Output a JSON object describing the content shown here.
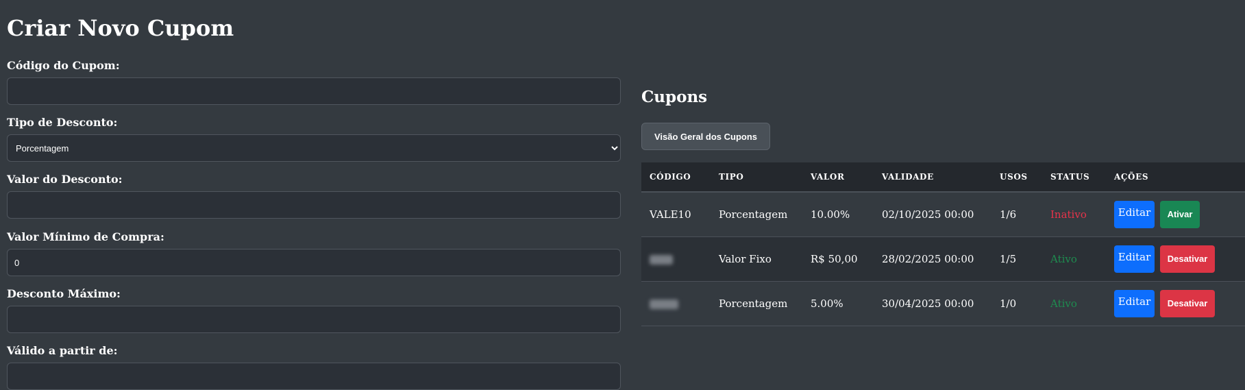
{
  "form": {
    "title": "Criar Novo Cupom",
    "code_label": "Código do Cupom:",
    "code_value": "",
    "type_label": "Tipo de Desconto:",
    "type_selected": "Porcentagem",
    "value_label": "Valor do Desconto:",
    "value_value": "",
    "min_label": "Valor Mínimo de Compra:",
    "min_value": "0",
    "max_label": "Desconto Máximo:",
    "max_value": "",
    "valid_from_label": "Válido a partir de:"
  },
  "coupons": {
    "title": "Cupons",
    "overview_button": "Visão Geral dos Cupons",
    "headers": [
      "CÓDIGO",
      "TIPO",
      "VALOR",
      "VALIDADE",
      "USOS",
      "STATUS",
      "AÇÕES"
    ],
    "rows": [
      {
        "code": "VALE10",
        "type": "Porcentagem",
        "value": "10.00%",
        "validity": "02/10/2025 00:00",
        "uses": "1/6",
        "status": "Inativo",
        "edit": "Editar",
        "toggle": "Ativar"
      },
      {
        "code": "",
        "type": "Valor Fixo",
        "value": "R$ 50,00",
        "validity": "28/02/2025 00:00",
        "uses": "1/5",
        "status": "Ativo",
        "edit": "Editar",
        "toggle": "Desativar"
      },
      {
        "code": "",
        "type": "Porcentagem",
        "value": "5.00%",
        "validity": "30/04/2025 00:00",
        "uses": "1/0",
        "status": "Ativo",
        "edit": "Editar",
        "toggle": "Desativar"
      }
    ]
  },
  "colors": {
    "background": "#343a40",
    "primary": "#0d6efd",
    "success": "#198754",
    "danger": "#dc3545"
  }
}
